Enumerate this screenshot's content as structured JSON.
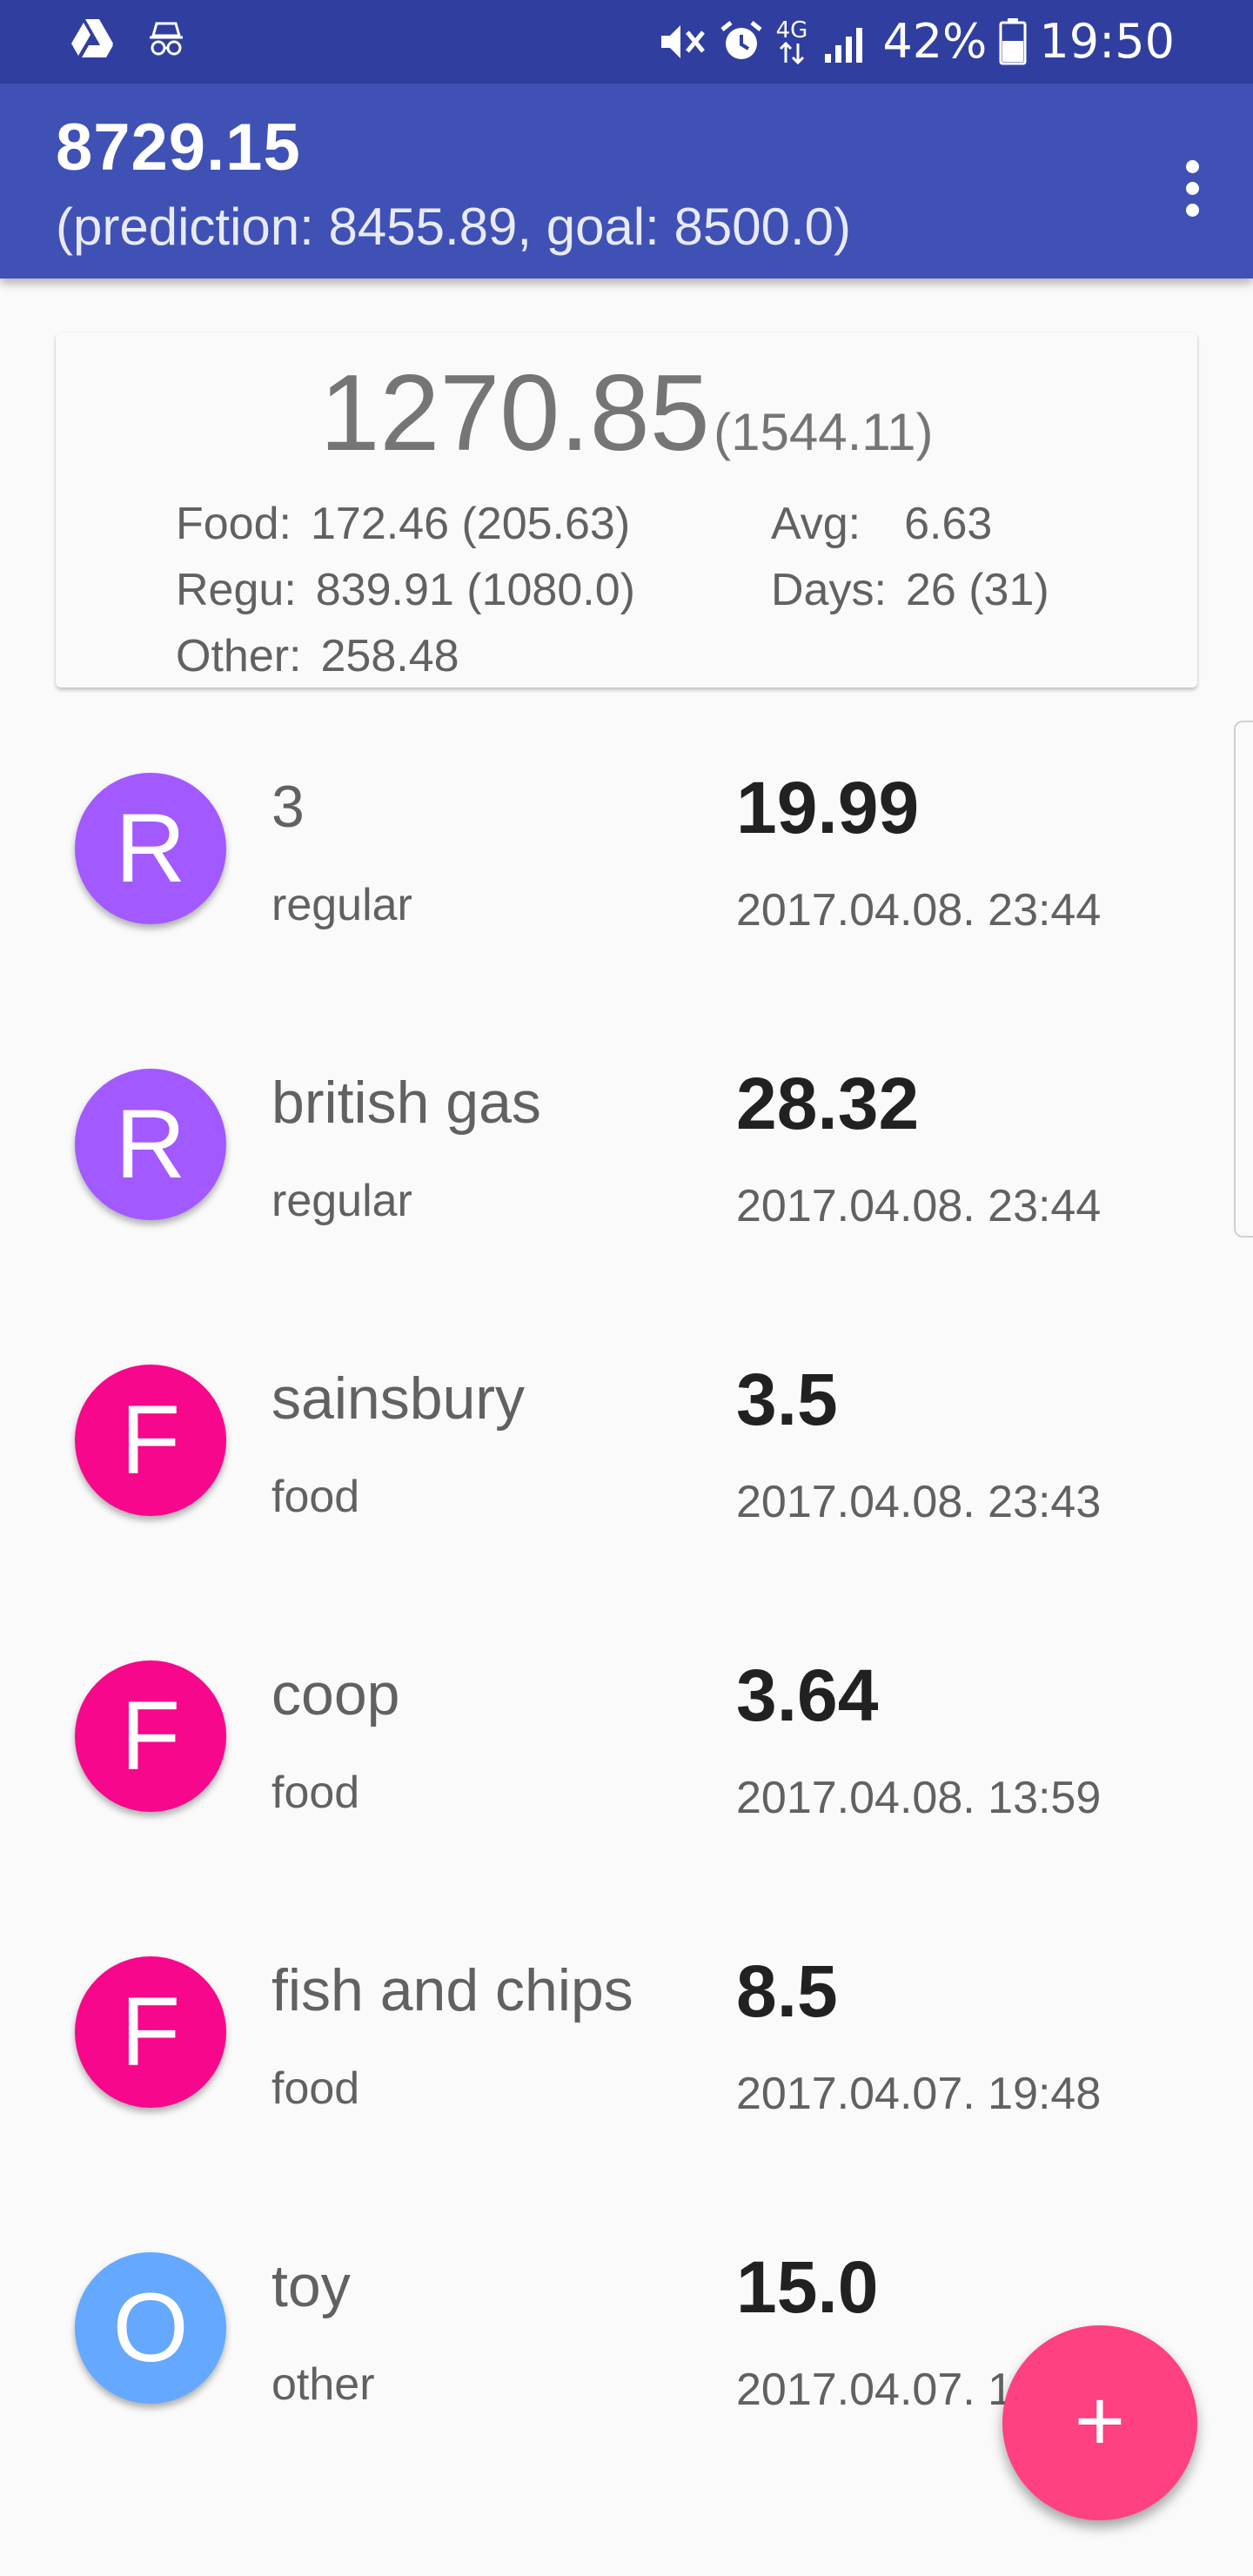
{
  "status_bar": {
    "battery_text": "42%",
    "time": "19:50",
    "network_label": "4G",
    "left_icons": [
      "drive-icon",
      "incognito-icon"
    ],
    "right_icons": [
      "mute-icon",
      "alarm-icon",
      "data-arrows-icon",
      "signal-icon",
      "battery-icon"
    ]
  },
  "toolbar": {
    "title": "8729.15",
    "subtitle": "(prediction: 8455.89, goal: 8500.0)",
    "menu_icon": "more-vert-icon"
  },
  "summary": {
    "total": "1270.85",
    "total_sub": "(1544.11)",
    "food_label": "Food:",
    "food_value": "172.46 (205.63)",
    "regu_label": "Regu:",
    "regu_value": "839.91 (1080.0)",
    "other_label": "Other:",
    "other_value": "258.48",
    "avg_label": "Avg:",
    "avg_value": "6.63",
    "days_label": "Days:",
    "days_value": "26 (31)"
  },
  "items": [
    {
      "letter": "R",
      "name": "3",
      "category": "regular",
      "amount": "19.99",
      "date": "2017.04.08. 23:44",
      "color": "#a259ff"
    },
    {
      "letter": "R",
      "name": "british gas",
      "category": "regular",
      "amount": "28.32",
      "date": "2017.04.08. 23:44",
      "color": "#a259ff"
    },
    {
      "letter": "F",
      "name": "sainsbury",
      "category": "food",
      "amount": "3.5",
      "date": "2017.04.08. 23:43",
      "color": "#f7078c"
    },
    {
      "letter": "F",
      "name": "coop",
      "category": "food",
      "amount": "3.64",
      "date": "2017.04.08. 13:59",
      "color": "#f7078c"
    },
    {
      "letter": "F",
      "name": "fish and chips",
      "category": "food",
      "amount": "8.5",
      "date": "2017.04.07. 19:48",
      "color": "#f7078c"
    },
    {
      "letter": "O",
      "name": "toy",
      "category": "other",
      "amount": "15.0",
      "date": "2017.04.07. 1",
      "color": "#64a8ff"
    }
  ],
  "fab": {
    "label": "+",
    "icon": "add-icon",
    "color": "#ff4081"
  },
  "colors": {
    "primary": "#3f51b5",
    "primary_dark": "#303f9f",
    "accent": "#ff4081"
  }
}
